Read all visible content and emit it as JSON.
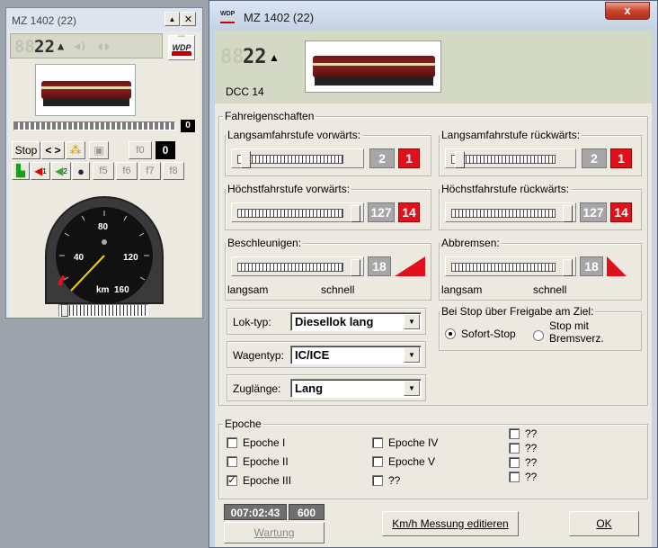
{
  "small_window": {
    "title": "MZ 1402  (22)",
    "led_speed": "22",
    "led_dim": "88",
    "logo": "WDP",
    "counter": "0",
    "stop_label": "Stop",
    "dir_label": "< >",
    "f0_label": "f0",
    "f0_value": "0",
    "fn_row": [
      "f5",
      "f6",
      "f7",
      "f8"
    ],
    "f1_sub": "1",
    "f2_sub": "2",
    "gauge": {
      "ticks": [
        "40",
        "80",
        "120",
        "160"
      ],
      "unit": "km"
    }
  },
  "main_window": {
    "title": "MZ 1402  (22)",
    "close_label": "x",
    "led_speed": "22",
    "led_dim": "88",
    "decoder": "DCC 14",
    "fahr": {
      "title": "Fahreigenschaften",
      "langsam_vor": {
        "label": "Langsamfahrstufe vorwärts:",
        "grey": "2",
        "red": "1"
      },
      "langsam_rueck": {
        "label": "Langsamfahrstufe rückwärts:",
        "grey": "2",
        "red": "1"
      },
      "hoechst_vor": {
        "label": "Höchstfahrstufe vorwärts:",
        "grey": "127",
        "red": "14"
      },
      "hoechst_rueck": {
        "label": "Höchstfahrstufe rückwärts:",
        "grey": "127",
        "red": "14"
      },
      "beschl": {
        "label": "Beschleunigen:",
        "value": "18",
        "min": "langsam",
        "max": "schnell"
      },
      "abbrems": {
        "label": "Abbremsen:",
        "value": "18",
        "min": "langsam",
        "max": "schnell"
      },
      "lok_typ": {
        "label": "Lok-typ:",
        "value": "Diesellok lang"
      },
      "wagentyp": {
        "label": "Wagentyp:",
        "value": "IC/ICE"
      },
      "zuglaenge": {
        "label": "Zuglänge:",
        "value": "Lang"
      },
      "stop_group": {
        "title": "Bei Stop über Freigabe am Ziel:",
        "opt1": "Sofort-Stop",
        "opt2a": "Stop mit",
        "opt2b": "Bremsverz."
      }
    },
    "epoche": {
      "title": "Epoche",
      "items": [
        {
          "label": "Epoche I",
          "checked": false
        },
        {
          "label": "Epoche II",
          "checked": false
        },
        {
          "label": "Epoche III",
          "checked": true
        },
        {
          "label": "Epoche IV",
          "checked": false
        },
        {
          "label": "Epoche V",
          "checked": false
        },
        {
          "label": "??",
          "checked": false
        },
        {
          "label": "??",
          "checked": false
        },
        {
          "label": "??",
          "checked": false
        },
        {
          "label": "??",
          "checked": false
        },
        {
          "label": "??",
          "checked": false
        }
      ]
    },
    "footer": {
      "time": "007:02:43",
      "count": "600",
      "wartung": "Wartung",
      "messung": "Km/h Messung editieren",
      "ok": "OK"
    }
  }
}
